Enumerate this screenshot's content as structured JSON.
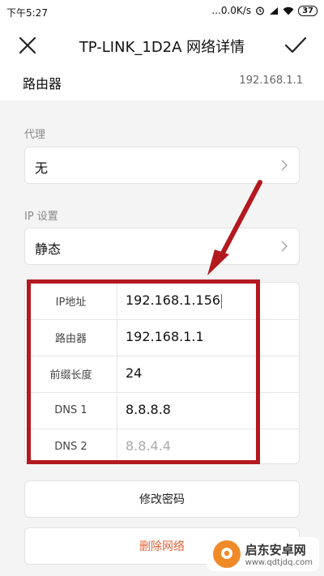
{
  "status_bar": {
    "time": "下午5:27",
    "network_speed": "...0.0K/s",
    "battery": "37"
  },
  "header": {
    "title": "TP-LINK_1D2A  网络详情"
  },
  "router": {
    "label": "路由器",
    "value": "192.168.1.1"
  },
  "proxy": {
    "section_label": "代理",
    "value": "无"
  },
  "ip_settings": {
    "section_label": "IP 设置",
    "value": "静态"
  },
  "ip_fields": [
    {
      "key": "IP地址",
      "value": "192.168.1.156"
    },
    {
      "key": "路由器",
      "value": "192.168.1.1"
    },
    {
      "key": "前缀长度",
      "value": "24"
    },
    {
      "key": "DNS 1",
      "value": "8.8.8.8"
    },
    {
      "key": "DNS 2",
      "value": "8.8.4.4"
    }
  ],
  "buttons": {
    "change_password": "修改密码",
    "delete_network": "删除网络"
  },
  "watermark": {
    "title": "启东安卓网",
    "url": "www.qdtjdq.com"
  },
  "colors": {
    "annotation_red": "#b3191f",
    "delete_orange": "#e0643a"
  }
}
